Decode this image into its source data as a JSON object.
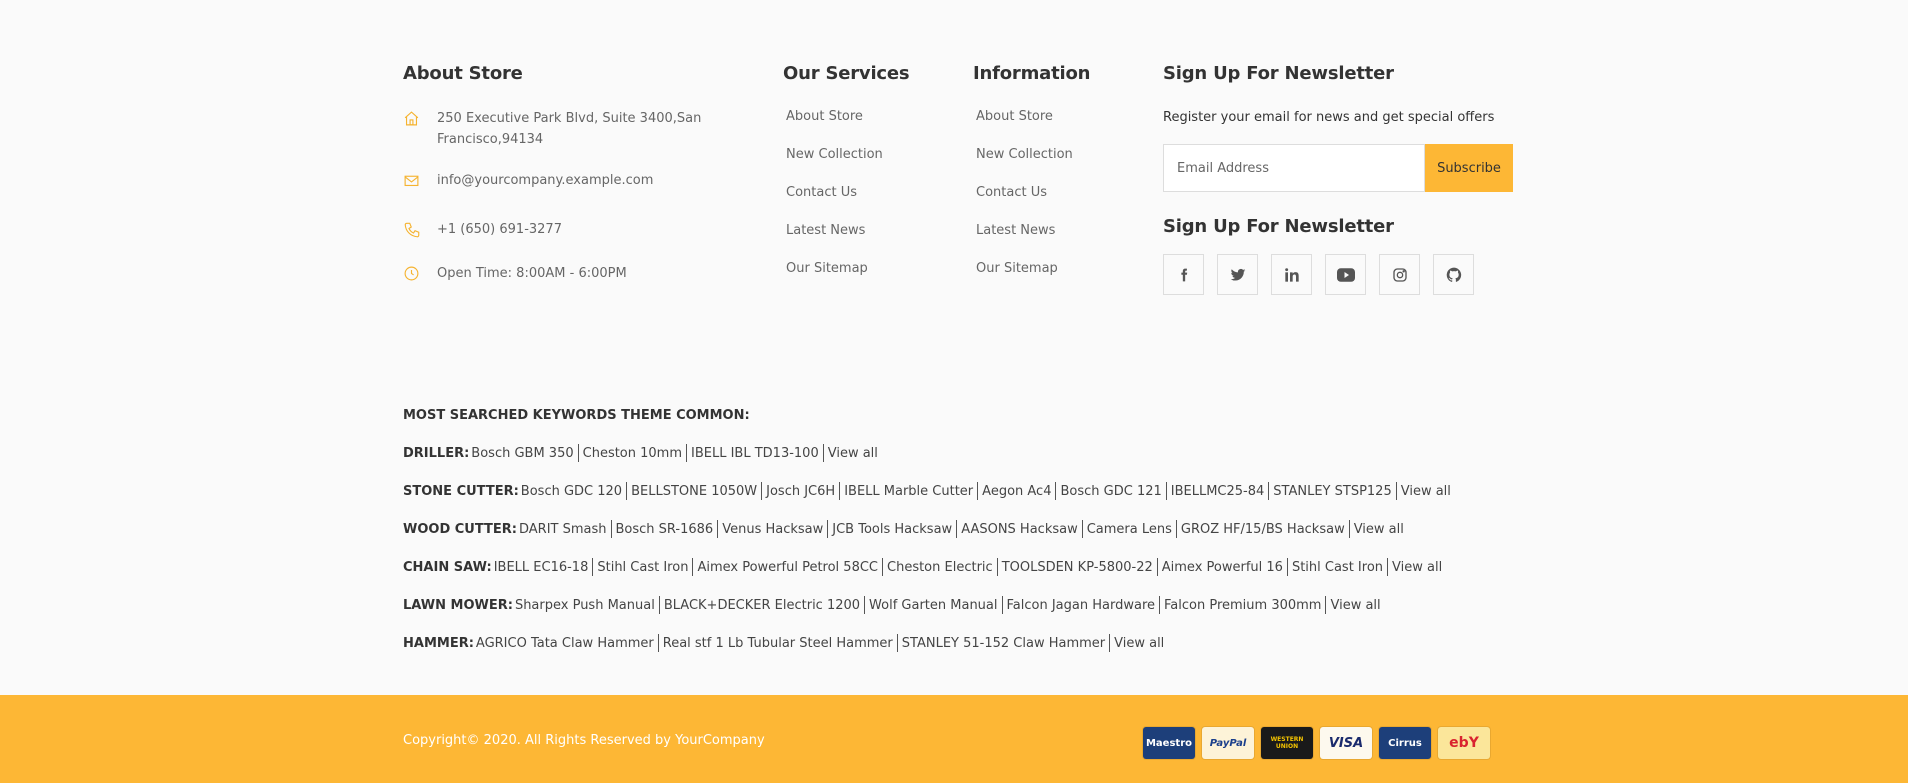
{
  "about": {
    "title": "About Store",
    "address": "250 Executive Park Blvd, Suite 3400,San Francisco,94134",
    "email": "info@yourcompany.example.com",
    "phone": "+1 (650) 691-3277",
    "hours": "Open Time: 8:00AM - 6:00PM"
  },
  "services": {
    "title": "Our Services",
    "links": [
      "About Store",
      "New Collection",
      "Contact Us",
      "Latest News",
      "Our Sitemap"
    ]
  },
  "information": {
    "title": "Information",
    "links": [
      "About Store",
      "New Collection",
      "Contact Us",
      "Latest News",
      "Our Sitemap"
    ]
  },
  "newsletter": {
    "title": "Sign Up For Newsletter",
    "text": "Register your email for news and get special offers",
    "placeholder": "Email Address",
    "button": "Subscribe",
    "social_title": "Sign Up For Newsletter",
    "social_icons": [
      "facebook-icon",
      "twitter-icon",
      "linkedin-icon",
      "youtube-icon",
      "instagram-icon",
      "github-icon"
    ]
  },
  "keywords": {
    "title": "MOST SEARCHED KEYWORDS THEME COMMON:",
    "rows": [
      {
        "label": "DRILLER:",
        "items": [
          "Bosch GBM 350",
          "Cheston 10mm",
          "IBELL IBL TD13-100",
          "View all"
        ]
      },
      {
        "label": "STONE CUTTER:",
        "items": [
          "Bosch GDC 120",
          "BELLSTONE 1050W",
          "Josch JC6H",
          "IBELL Marble Cutter",
          "Aegon Ac4",
          "Bosch GDC 121",
          "IBELLMC25-84",
          "STANLEY STSP125",
          "View all"
        ]
      },
      {
        "label": "WOOD CUTTER:",
        "items": [
          "DARIT Smash",
          "Bosch SR-1686",
          "Venus Hacksaw",
          "JCB Tools Hacksaw",
          "AASONS Hacksaw",
          "Camera Lens",
          "GROZ HF/15/BS Hacksaw",
          "View all"
        ]
      },
      {
        "label": "CHAIN SAW:",
        "items": [
          "IBELL EC16-18",
          "Stihl Cast Iron",
          "Aimex Powerful Petrol 58CC",
          "Cheston Electric",
          "TOOLSDEN KP-5800-22",
          "Aimex Powerful 16",
          "Stihl Cast Iron",
          "View all"
        ]
      },
      {
        "label": "LAWN MOWER:",
        "items": [
          "Sharpex Push Manual",
          "BLACK+DECKER Electric 1200",
          "Wolf Garten Manual",
          "Falcon Jagan Hardware",
          "Falcon Premium 300mm",
          "View all"
        ]
      },
      {
        "label": "HAMMER:",
        "items": [
          "AGRICO Tata Claw Hammer",
          "Real stf 1 Lb Tubular Steel Hammer",
          "STANLEY 51-152 Claw Hammer",
          "View all"
        ]
      }
    ]
  },
  "footer": {
    "copyright": "Copyright© 2020. All Rights Reserved by YourCompany",
    "payments": [
      {
        "name": "maestro",
        "label": "Maestro",
        "bg": "#1d3f7a",
        "fg": "#ffffff"
      },
      {
        "name": "paypal",
        "label": "PayPal",
        "bg": "#fdf3d8",
        "fg": "#1b3f8b"
      },
      {
        "name": "western-union",
        "label": "WESTERN UNION",
        "bg": "#1a1a1a",
        "fg": "#f5c400"
      },
      {
        "name": "visa",
        "label": "VISA",
        "bg": "#fdf9ee",
        "fg": "#1a2a6c"
      },
      {
        "name": "cirrus",
        "label": "Cirrus",
        "bg": "#1d3f7a",
        "fg": "#ffffff"
      },
      {
        "name": "ebay",
        "label": "ebY",
        "bg": "#fbe69a",
        "fg": "#d9232f"
      }
    ]
  },
  "colors": {
    "accent": "#fdb735",
    "icon": "#f5b330"
  }
}
